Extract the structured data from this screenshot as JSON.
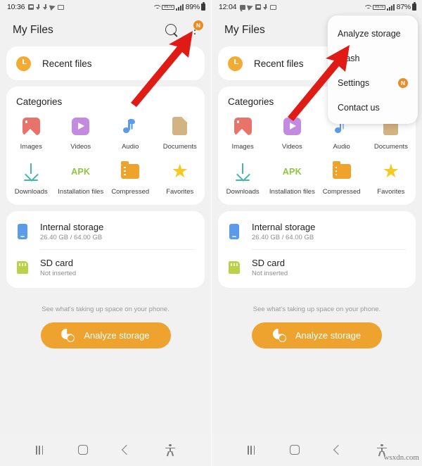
{
  "left_phone": {
    "status_bar": {
      "time": "10:36",
      "left_icons": [
        "message-icon",
        "download-icon",
        "upload-icon",
        "telegram-icon",
        "image-icon"
      ],
      "wifi": "wifi-icon",
      "volte": "VoLTE",
      "signal": "signal-bars-icon",
      "battery_percent": "89%",
      "battery": "battery-icon"
    },
    "header": {
      "title": "My Files",
      "search": "search-icon",
      "menu": "more-options-icon",
      "menu_badge": "N"
    },
    "recent": {
      "label": "Recent files",
      "icon": "clock-icon"
    },
    "categories": {
      "title": "Categories",
      "items": [
        {
          "label": "Images",
          "icon": "images-icon"
        },
        {
          "label": "Videos",
          "icon": "videos-icon"
        },
        {
          "label": "Audio",
          "icon": "audio-icon"
        },
        {
          "label": "Documents",
          "icon": "documents-icon"
        },
        {
          "label": "Downloads",
          "icon": "downloads-icon"
        },
        {
          "label": "Installation files",
          "icon": "apk-icon"
        },
        {
          "label": "Compressed",
          "icon": "compressed-icon"
        },
        {
          "label": "Favorites",
          "icon": "star-icon"
        }
      ]
    },
    "storage": [
      {
        "title": "Internal storage",
        "subtitle": "26.40 GB / 64.00 GB",
        "icon": "phone-icon"
      },
      {
        "title": "SD card",
        "subtitle": "Not inserted",
        "icon": "sd-card-icon"
      }
    ],
    "analyze": {
      "hint": "See what's taking up space on your phone.",
      "button": "Analyze storage",
      "icon": "pie-chart-search-icon"
    },
    "navbar": [
      "recents-button",
      "home-button",
      "back-button",
      "accessibility-button"
    ]
  },
  "right_phone": {
    "status_bar": {
      "time": "12:04",
      "left_icons": [
        "chat-icon",
        "telegram-icon",
        "message-icon",
        "download-icon",
        "image-icon"
      ],
      "wifi": "wifi-icon",
      "volte": "VoLTE",
      "signal": "signal-bars-icon",
      "battery_percent": "87%",
      "battery": "battery-icon"
    },
    "header": {
      "title": "My Files"
    },
    "menu": {
      "items": [
        {
          "label": "Analyze storage",
          "badge": ""
        },
        {
          "label": "Trash",
          "badge": ""
        },
        {
          "label": "Settings",
          "badge": "N"
        },
        {
          "label": "Contact us",
          "badge": ""
        }
      ]
    }
  },
  "annotations": {
    "arrow_color": "#e01b16",
    "left_arrow_target": "more-options-icon",
    "right_arrow_target": "Trash"
  },
  "watermark": "wsxdn.com"
}
